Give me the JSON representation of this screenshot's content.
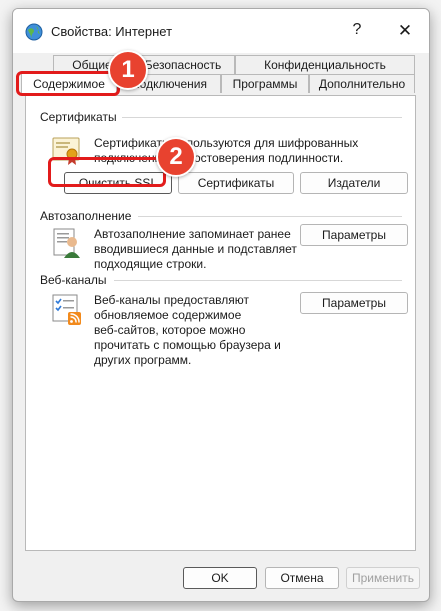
{
  "window": {
    "title": "Свойства: Интернет",
    "help": "?",
    "close": "✕"
  },
  "tabs": {
    "row1": [
      "Общие",
      "Безопасность",
      "Конфиденциальность"
    ],
    "row2": [
      "Содержимое",
      "Подключения",
      "Программы",
      "Дополнительно"
    ],
    "active": "Содержимое"
  },
  "certificates": {
    "label": "Сертификаты",
    "desc1": "Сертификаты используются для шифрованных",
    "desc2": "подключений и удостоверения подлинности.",
    "clear_ssl": "Очистить SSL",
    "certs": "Сертификаты",
    "publishers": "Издатели"
  },
  "autocomplete": {
    "label": "Автозаполнение",
    "desc1": "Автозаполнение запоминает ранее",
    "desc2": "вводившиеся данные и подставляет",
    "desc3": "подходящие строки.",
    "settings": "Параметры"
  },
  "feeds": {
    "label": "Веб-каналы",
    "desc1": "Веб-каналы предоставляют",
    "desc2": "обновляемое содержимое",
    "desc3": "веб-сайтов, которое можно",
    "desc4": "прочитать с помощью браузера и",
    "desc5": "других программ.",
    "settings": "Параметры"
  },
  "footer": {
    "ok": "OK",
    "cancel": "Отмена",
    "apply": "Применить"
  },
  "annotations": {
    "badge1": "1",
    "badge2": "2",
    "highlight_color": "#e21b1b",
    "badge_color": "#e8422f"
  }
}
